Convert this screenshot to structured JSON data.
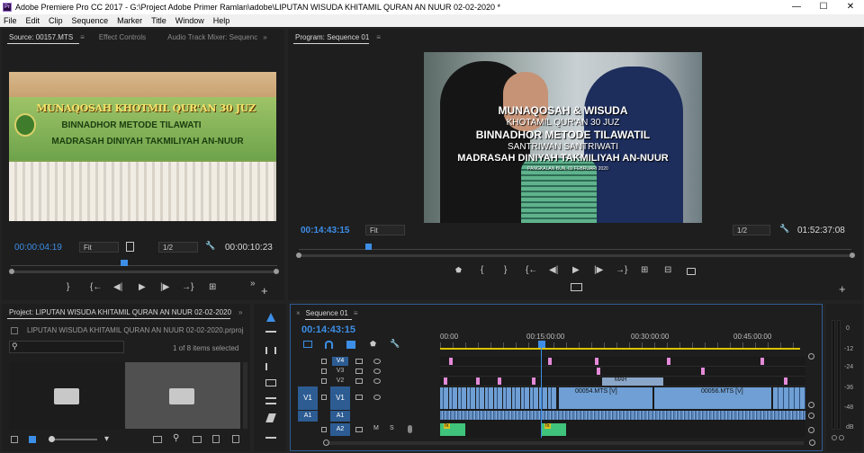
{
  "app": {
    "window_title": "Adobe Premiere Pro CC 2017 - G:\\Project Adobe Primer Ramlan\\adobe\\LIPUTAN WISUDA KHITAMIL QURAN AN NUUR 02-02-2020 *",
    "logo_text": "Pr",
    "min_label": "—",
    "max_label": "☐",
    "close_label": "✕"
  },
  "menu": [
    "File",
    "Edit",
    "Clip",
    "Sequence",
    "Marker",
    "Title",
    "Window",
    "Help"
  ],
  "source_panel": {
    "tabs": [
      "Source: 00157.MTS",
      "Effect Controls",
      "Audio Track Mixer: Sequenc"
    ],
    "menu_icon": "≡",
    "overflow_icon": "»",
    "banner_lines": [
      "MUNAQOSAH KHOTMIL QUR'AN 30 JUZ",
      "BINNADHOR METODE TILAWATI",
      "MADRASAH DINIYAH TAKMILIYAH AN-NUUR"
    ],
    "timecode": "00:00:04:19",
    "fit": "Fit",
    "resolution": "1/2",
    "duration": "00:00:10:23"
  },
  "program_panel": {
    "tab": "Program: Sequence 01",
    "menu_icon": "≡",
    "overlay_lines": [
      "MUNAQOSAH & WISUDA",
      "KHOTAMIL QUR'AN 30 JUZ",
      "BINNADHOR METODE TILAWATIL",
      "SANTRIWAN SANTRIWATI",
      "MADRASAH DINIYAH TAKMILIYAH AN-NUUR",
      "PANGKALAN BUN, 02 FEBRUARI 2020"
    ],
    "timecode": "00:14:43:15",
    "fit": "Fit",
    "resolution": "1/2",
    "duration": "01:52:37:08"
  },
  "project_panel": {
    "tab": "Project: LIPUTAN WISUDA KHITAMIL QURAN AN NUUR 02-02-2020",
    "file": "LIPUTAN WISUDA KHITAMIL QURAN AN NUUR 02-02-2020.prproj",
    "items_selected": "1 of 8 items selected",
    "overflow_icon": "»"
  },
  "timeline": {
    "tab": "Sequence 01",
    "menu_icon": "≡",
    "timecode": "00:14:43:15",
    "ruler": [
      "00:00",
      "00:15:00:00",
      "00:30:00:00",
      "00:45:00:00"
    ],
    "video_tracks": [
      "V4",
      "V3",
      "V2",
      "V1"
    ],
    "audio_tracks": [
      "A1",
      "A2"
    ],
    "source_patch_v": "V1",
    "source_patch_a": "A1",
    "mute_label": "M",
    "solo_label": "S",
    "clips": [
      "00054.MTS [V]",
      "00056.MTS [V]",
      "MAH"
    ],
    "fx_label": "fx"
  },
  "meter": {
    "labels": [
      "0",
      "-12",
      "-24",
      "-36",
      "-48",
      "dB"
    ]
  },
  "colors": {
    "accent_blue": "#3d8ee6",
    "clip_blue": "#6f9fd4",
    "marker_pink": "#e48ad8",
    "audio_green": "#40c37a",
    "work_area_yellow": "#d9c400"
  },
  "icons": {
    "marker": "⬟",
    "in": "{",
    "out": "}",
    "go_in": "{←",
    "step_back": "◀|",
    "play": "▶",
    "step_fwd": "|▶",
    "go_out": "→}",
    "insert": "⊞",
    "overwrite": "⊟",
    "export_frame": "📷",
    "add": "+",
    "wrench": "🔧",
    "search": "⚲",
    "settings": "▾"
  }
}
